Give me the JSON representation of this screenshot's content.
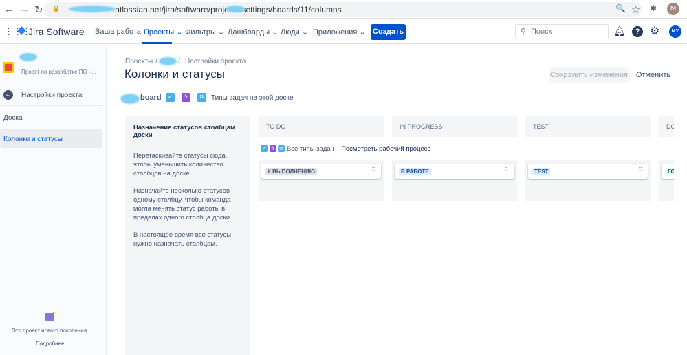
{
  "browser": {
    "url": ".atlassian.net/jira/software/projects/settings/boards/11/columns"
  },
  "topnav": {
    "logo": "Jira Software",
    "items": [
      "Ваша работа",
      "Проекты",
      "Фильтры",
      "Дашбоарды",
      "Люди",
      "Приложения"
    ],
    "create": "Создать",
    "search_placeholder": "Поиск",
    "avatar": "MY"
  },
  "sidebar": {
    "project_desc": "Проект по разработке ПО н...",
    "back": "Настройки проекта",
    "items": [
      "Доска",
      "Колонки и статусы"
    ],
    "footer_text": "Это проект нового поколения",
    "footer_link": "Подробнее"
  },
  "main": {
    "breadcrumb": [
      "Проекты",
      "Настройки проекта"
    ],
    "title": "Колонки и статусы",
    "save": "Сохранить изменения",
    "cancel": "Отменить",
    "board": "board",
    "issue_types": "Типы задач на этой доске",
    "info_title": "Назначение статусов столбцам доски",
    "info_p1": "Перетаскивайте статусы сюда, чтобы уменьшить количество столбцов на доске.",
    "info_p2": "Назначайте несколько статусов одному столбцу, чтобы команда могла менять статус работы в пределах одного столбца доски.",
    "info_p3": "В настоящее время все статусы нужно назначать столбцам.",
    "all_types": "Все типы задач",
    "view_workflow": "Посмотреть рабочий процесс",
    "columns": [
      {
        "name": "TO DO",
        "status": "К ВЫПОЛНЕНИЮ"
      },
      {
        "name": "IN PROGRESS",
        "status": "В РАБОТЕ"
      },
      {
        "name": "TEST",
        "status": "TEST"
      },
      {
        "name": "DO",
        "status": "ГО"
      }
    ]
  },
  "colors": {
    "accent": "#0052cc",
    "todo_bg": "#dfe1e6",
    "progress_bg": "#deebff",
    "done_bg": "#e3fcef"
  }
}
